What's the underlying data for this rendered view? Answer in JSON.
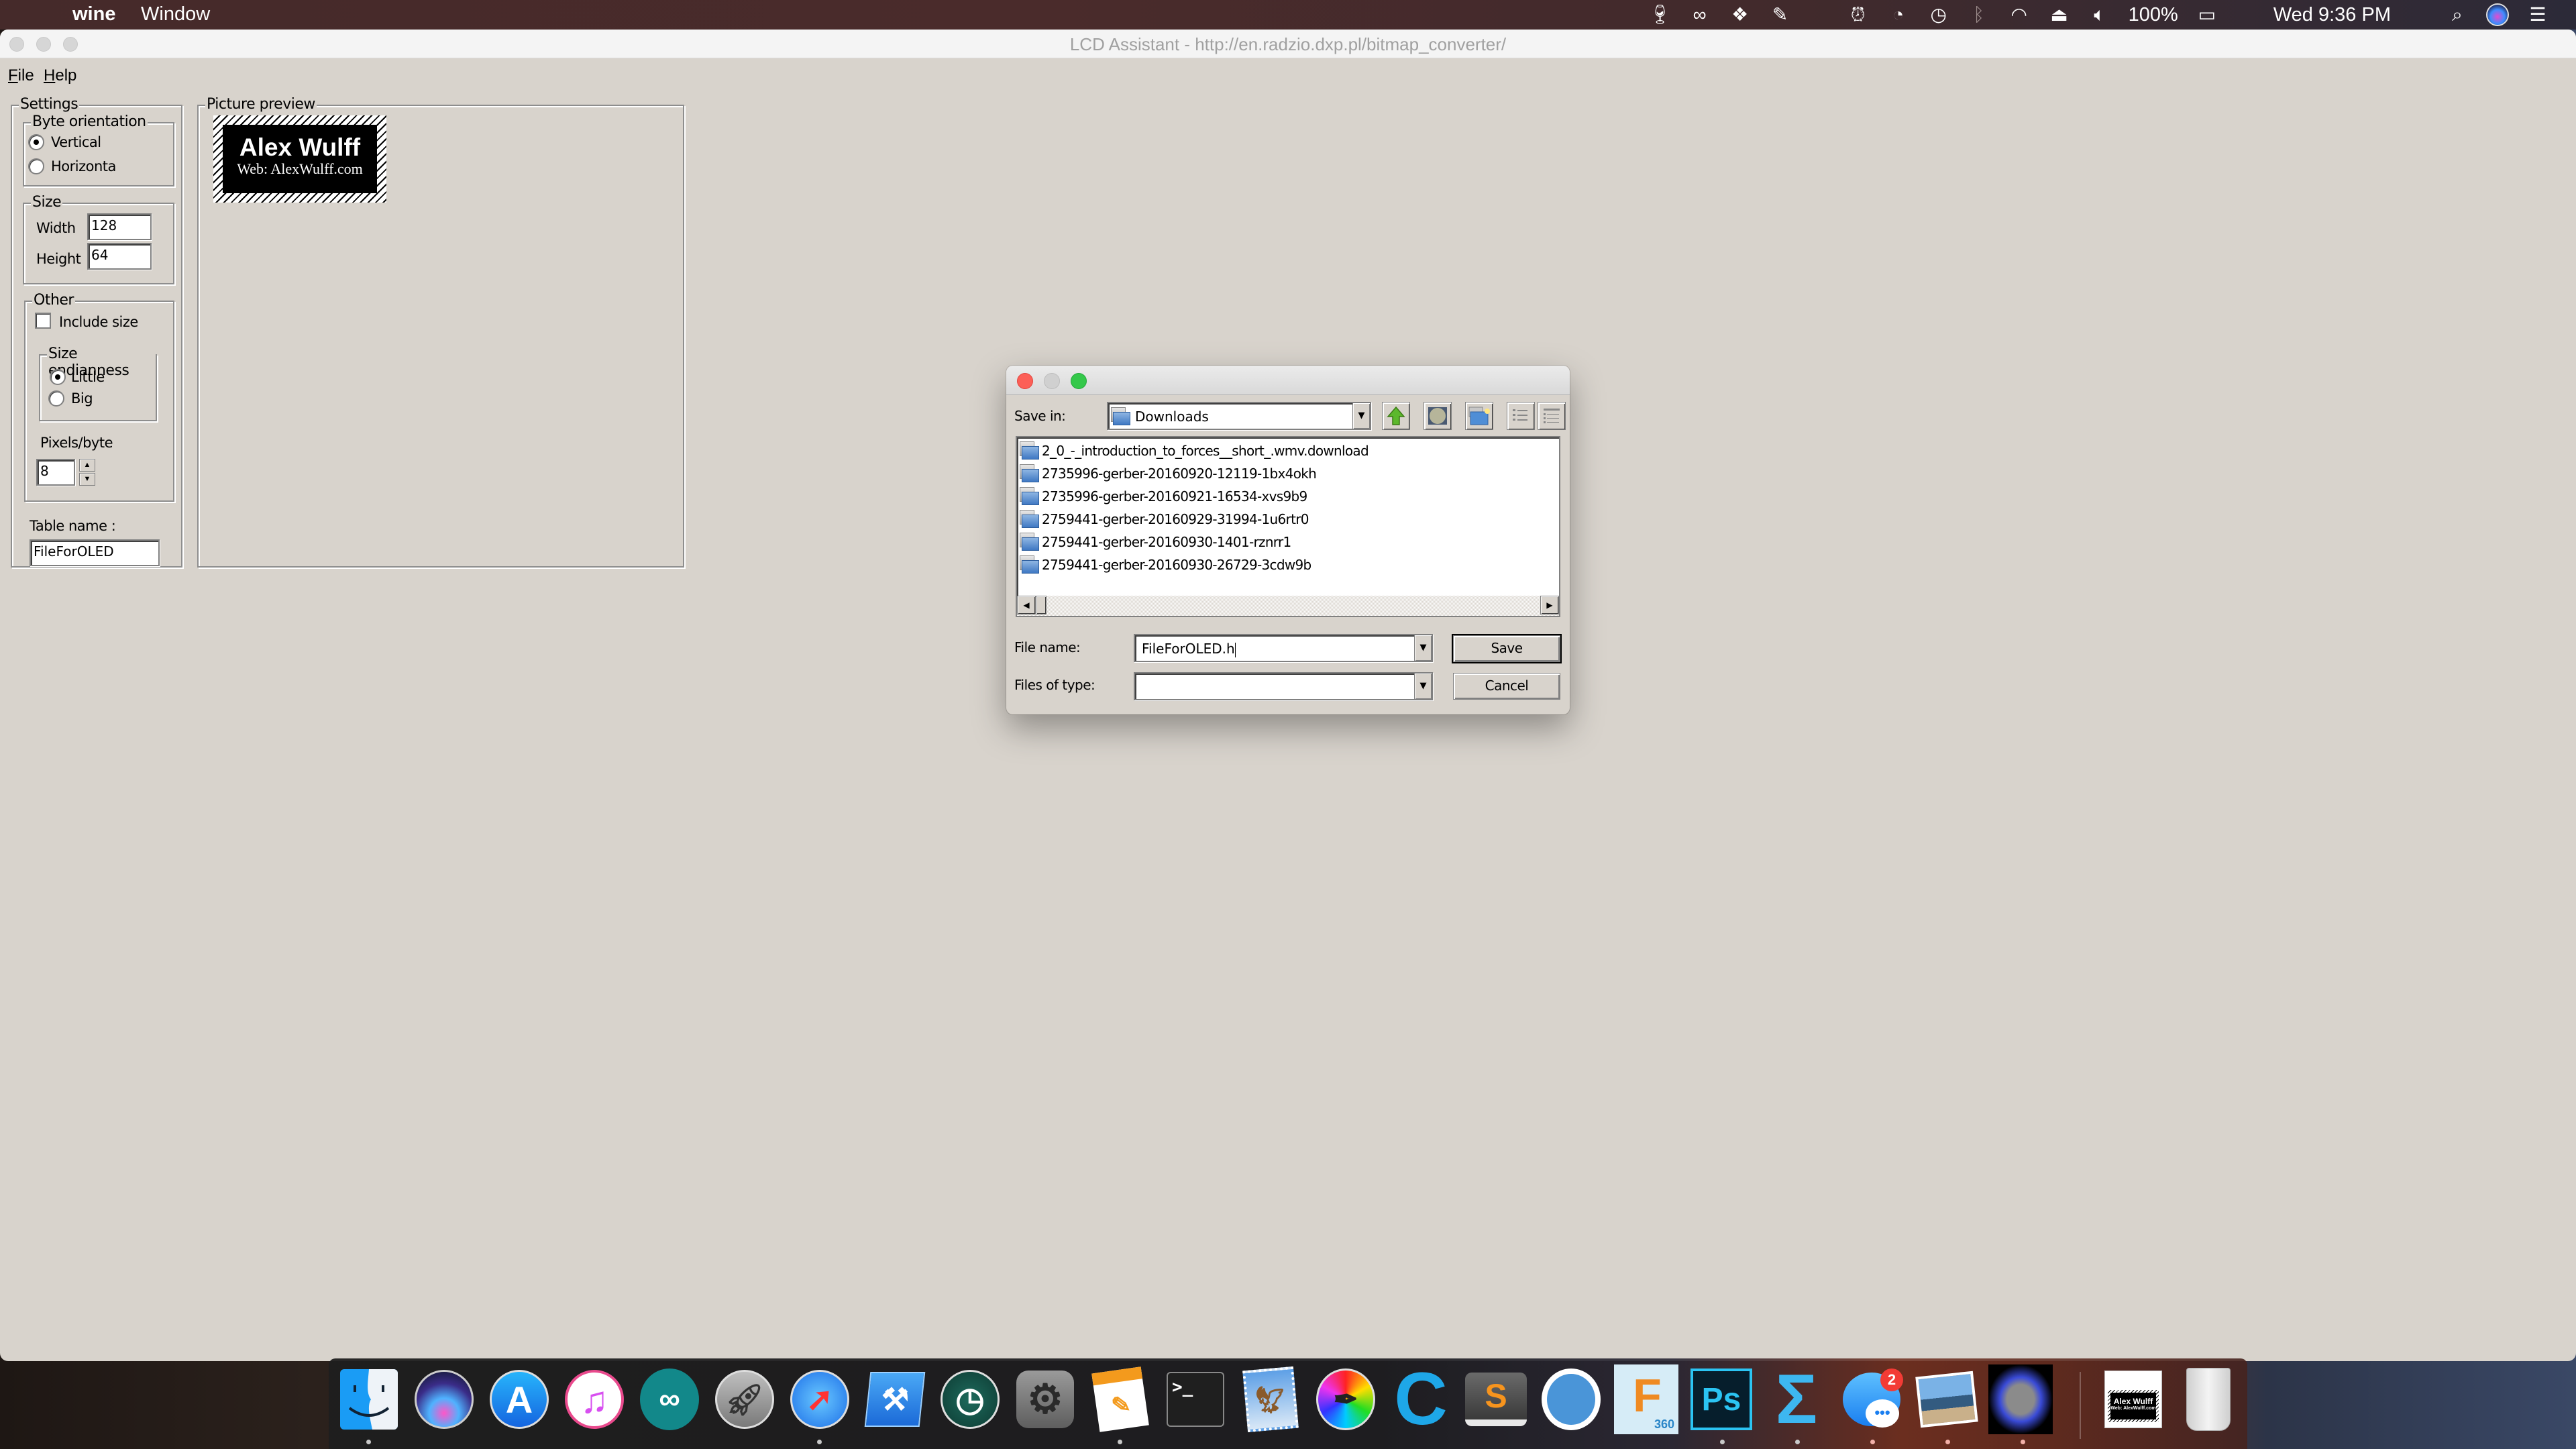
{
  "menubar": {
    "app_name": "wine",
    "menus": [
      "Window"
    ],
    "status": {
      "battery": "100%",
      "clock": "Wed 9:36 PM"
    },
    "status_icons": [
      "wine-glass-icon",
      "creative-cloud-icon",
      "dropbox-icon",
      "evernote-icon",
      "alarm-icon",
      "sync-icon",
      "time-machine-icon",
      "bluetooth-icon",
      "wifi-icon",
      "airplay-icon",
      "volume-icon",
      "battery-icon",
      "spotlight-icon",
      "siri-icon",
      "notification-center-icon"
    ]
  },
  "window": {
    "title": "LCD Assistant -  http://en.radzio.dxp.pl/bitmap_converter/",
    "menu": [
      {
        "label": "File",
        "mnemonic": "F"
      },
      {
        "label": "Help",
        "mnemonic": "H"
      }
    ]
  },
  "settings": {
    "group_label": "Settings",
    "byte_orientation": {
      "label": "Byte orientation",
      "options": [
        "Vertical",
        "Horizonta"
      ],
      "selected": "Vertical"
    },
    "size": {
      "label": "Size",
      "width_label": "Width",
      "width_value": "128",
      "height_label": "Height",
      "height_value": "64"
    },
    "other": {
      "label": "Other",
      "include_size_label": "Include size",
      "include_size_checked": false,
      "endianness": {
        "label": "Size endianness",
        "options": [
          "Little",
          "Big"
        ],
        "selected": "Little"
      },
      "pixels_per_byte_label": "Pixels/byte",
      "pixels_per_byte_value": "8"
    },
    "table_name_label": "Table name :",
    "table_name_value": "FileForOLED"
  },
  "preview": {
    "group_label": "Picture preview",
    "image_title": "Alex Wulff",
    "image_subtitle": "Web: AlexWulff.com"
  },
  "save_dialog": {
    "save_in_label": "Save in:",
    "save_in_value": "Downloads",
    "toolbar": [
      "up-folder-icon",
      "desktop-icon",
      "new-folder-icon",
      "list-view-icon",
      "details-view-icon"
    ],
    "files": [
      "2_0_-_introduction_to_forces__short_.wmv.download",
      "2735996-gerber-20160920-12119-1bx4okh",
      "2735996-gerber-20160921-16534-xvs9b9",
      "2759441-gerber-20160929-31994-1u6rtr0",
      "2759441-gerber-20160930-1401-rznrr1",
      "2759441-gerber-20160930-26729-3cdw9b"
    ],
    "file_name_label": "File name:",
    "file_name_value": "FileForOLED.h",
    "files_of_type_label": "Files of type:",
    "files_of_type_value": "",
    "save_label": "Save",
    "cancel_label": "Cancel"
  },
  "dock": {
    "apps": [
      {
        "name": "Finder",
        "running": true
      },
      {
        "name": "Siri",
        "running": false
      },
      {
        "name": "App Store",
        "running": false
      },
      {
        "name": "iTunes",
        "running": false
      },
      {
        "name": "Arduino",
        "running": false
      },
      {
        "name": "Launchpad",
        "running": false
      },
      {
        "name": "Safari",
        "running": true
      },
      {
        "name": "Xcode",
        "running": false
      },
      {
        "name": "Time Machine",
        "running": false
      },
      {
        "name": "System Preferences",
        "running": false
      },
      {
        "name": "Pages",
        "running": true
      },
      {
        "name": "Terminal",
        "running": false
      },
      {
        "name": "Mail",
        "running": false
      },
      {
        "name": "Color Picker",
        "running": false
      },
      {
        "name": "Cinema 4D",
        "running": false
      },
      {
        "name": "Sublime Text",
        "running": false
      },
      {
        "name": "Simplenote",
        "running": false
      },
      {
        "name": "Fusion 360",
        "running": true
      },
      {
        "name": "Photoshop",
        "running": true
      },
      {
        "name": "Sigma",
        "running": true
      },
      {
        "name": "Messages",
        "running": true,
        "badge": "2"
      },
      {
        "name": "Preview",
        "running": true
      },
      {
        "name": "Wine",
        "running": true
      }
    ],
    "documents": [
      {
        "name": "Alex Wulff bitmap",
        "label": "Alex Wulff",
        "sublabel": "Web: AlexWulff.com"
      },
      {
        "name": "Trash"
      }
    ],
    "terminal_prompt": ">_",
    "sublime_letter": "S",
    "fusion_label": "F",
    "fusion_sub": "360",
    "ps_label": "Ps",
    "sigma_label": "Σ",
    "c_label": "C"
  }
}
